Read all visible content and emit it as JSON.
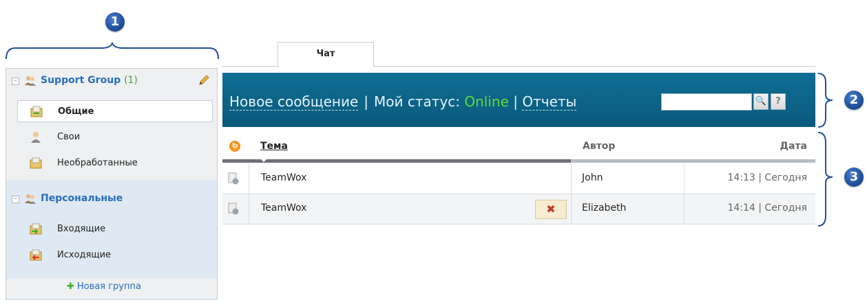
{
  "callouts": [
    "1",
    "2",
    "3"
  ],
  "sidebar": {
    "groups": [
      {
        "title": "Support Group",
        "count": "(1)",
        "toggle": "−"
      },
      {
        "title": "Персональные",
        "toggle": "−"
      }
    ],
    "items": [
      {
        "label": "Общие",
        "icon": "inbox-folder-icon",
        "active": true
      },
      {
        "label": "Свои",
        "icon": "user-icon"
      },
      {
        "label": "Необработанные",
        "icon": "folder-icon"
      },
      {
        "label": "Входящие",
        "icon": "incoming-icon"
      },
      {
        "label": "Исходящие",
        "icon": "outgoing-icon"
      }
    ],
    "new_group": "Новая группа"
  },
  "tabs": [
    {
      "label": "Чат"
    }
  ],
  "header": {
    "new_message": "Новое сообщение",
    "separator": "|",
    "status_label": "Мой статус:",
    "status_value": "Online",
    "reports": "Отчеты",
    "search_placeholder": "",
    "search_icon": "🔍",
    "help_label": "?"
  },
  "table": {
    "columns": {
      "topic": "Тема",
      "author": "Автор",
      "date": "Дата"
    },
    "rows": [
      {
        "topic": "TeamWox",
        "author": "John",
        "time": "14:13",
        "day": "Сегодня"
      },
      {
        "topic": "TeamWox",
        "author": "Elizabeth",
        "time": "14:14",
        "day": "Сегодня"
      }
    ],
    "delete_label": "✖"
  },
  "colors": {
    "accent": "#0f6d95",
    "online": "#5cdc3a",
    "link": "#2a6ebb"
  }
}
